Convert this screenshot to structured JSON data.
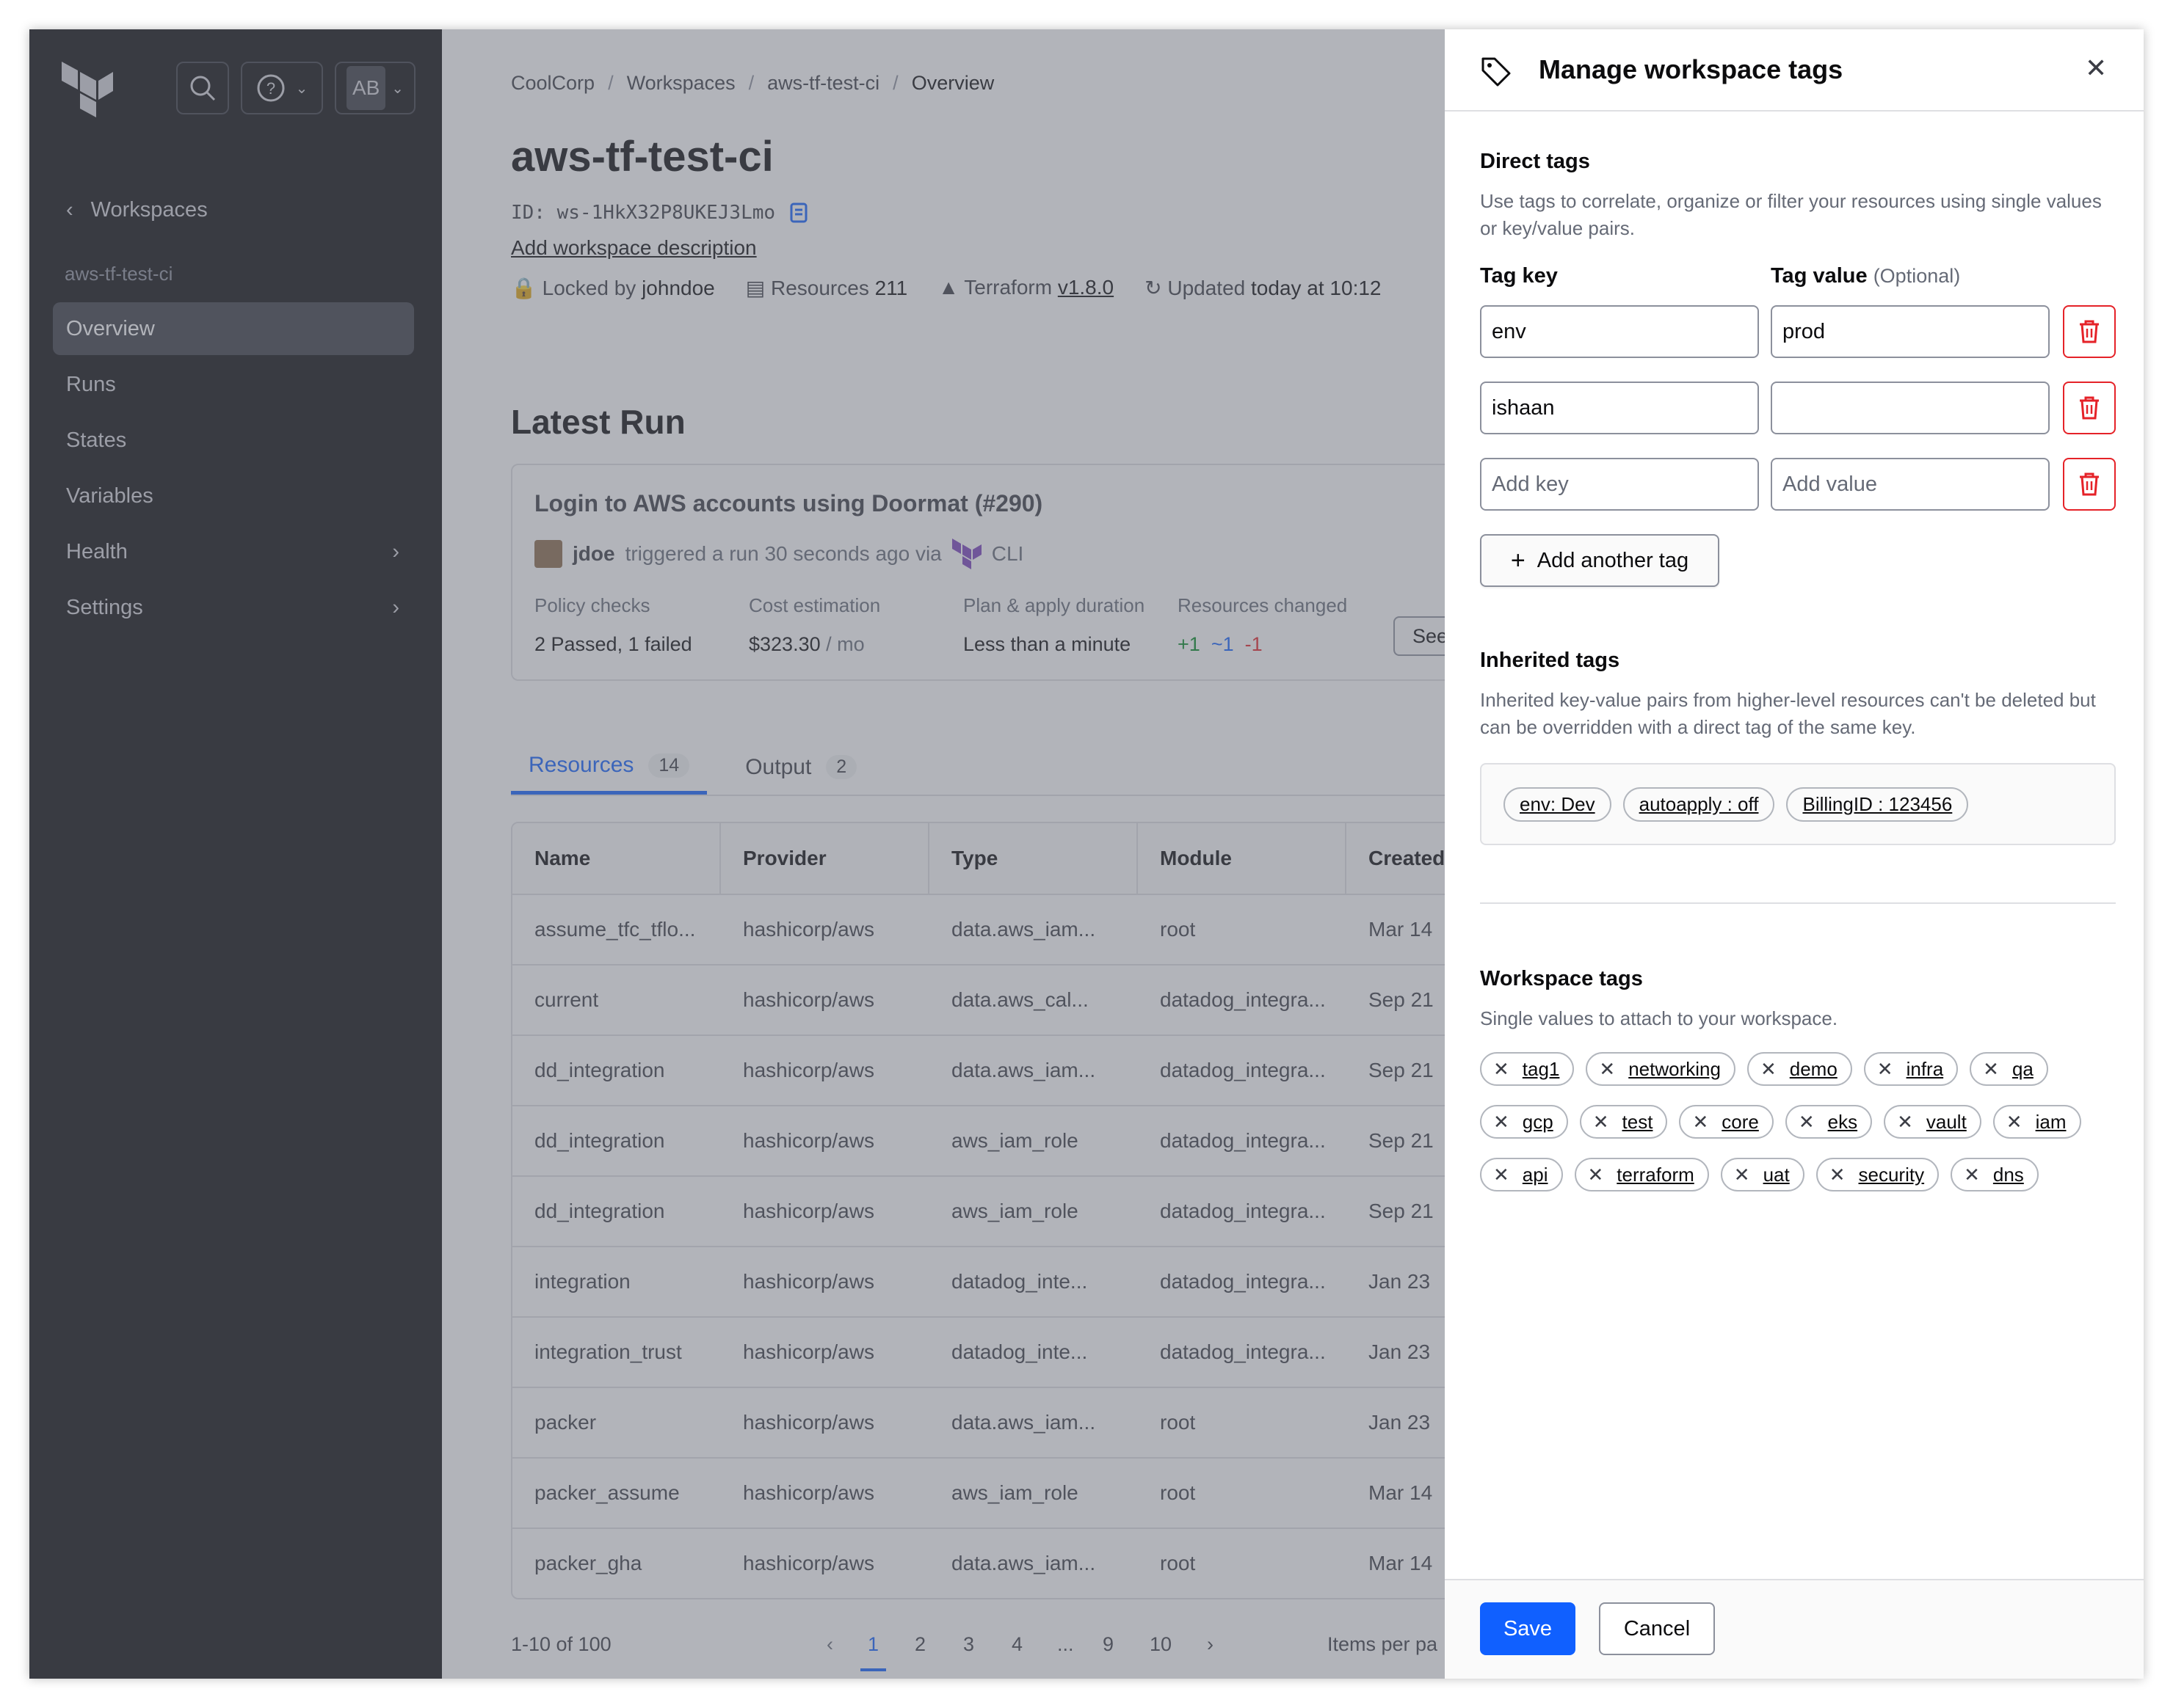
{
  "sidebar": {
    "back_label": "Workspaces",
    "workspace_name": "aws-tf-test-ci",
    "avatar_initials": "AB",
    "items": [
      {
        "label": "Overview",
        "active": true
      },
      {
        "label": "Runs"
      },
      {
        "label": "States"
      },
      {
        "label": "Variables"
      },
      {
        "label": "Health",
        "chevron": true
      },
      {
        "label": "Settings",
        "chevron": true
      }
    ]
  },
  "breadcrumb": [
    "CoolCorp",
    "Workspaces",
    "aws-tf-test-ci",
    "Overview"
  ],
  "workspace": {
    "title": "aws-tf-test-ci",
    "id_text": "ID: ws-1HkX32P8UKEJ3Lmo",
    "description_link": "Add workspace description",
    "locked_label": "Locked by",
    "locked_by": "johndoe",
    "resources_label": "Resources",
    "resources_count": "211",
    "terraform_label": "Terraform",
    "terraform_version": "v1.8.0",
    "updated_label": "Updated",
    "updated_value": "today at 10:12"
  },
  "latest_run": {
    "heading": "Latest Run",
    "title": "Login to AWS accounts using Doormat (#290)",
    "user": "jdoe",
    "trigger_text": "triggered a run 30 seconds ago via",
    "via": "CLI",
    "policy_label": "Policy checks",
    "policy_value": "2 Passed, 1 failed",
    "cost_label": "Cost estimation",
    "cost_value": "$323.30",
    "cost_unit": "/ mo",
    "duration_label": "Plan & apply duration",
    "duration_value": "Less than a minute",
    "changed_label": "Resources changed",
    "changed_add": "+1",
    "changed_change": "~1",
    "changed_destroy": "-1",
    "see_button": "See"
  },
  "tabs": [
    {
      "label": "Resources",
      "count": "14",
      "active": true
    },
    {
      "label": "Output",
      "count": "2"
    }
  ],
  "table": {
    "headers": [
      "Name",
      "Provider",
      "Type",
      "Module",
      "Created"
    ],
    "rows": [
      [
        "assume_tfc_tflo...",
        "hashicorp/aws",
        "data.aws_iam...",
        "root",
        "Mar 14"
      ],
      [
        "current",
        "hashicorp/aws",
        "data.aws_cal...",
        "datadog_integra...",
        "Sep 21"
      ],
      [
        "dd_integration",
        "hashicorp/aws",
        "data.aws_iam...",
        "datadog_integra...",
        "Sep 21"
      ],
      [
        "dd_integration",
        "hashicorp/aws",
        "aws_iam_role",
        "datadog_integra...",
        "Sep 21"
      ],
      [
        "dd_integration",
        "hashicorp/aws",
        "aws_iam_role",
        "datadog_integra...",
        "Sep 21"
      ],
      [
        "integration",
        "hashicorp/aws",
        "datadog_inte...",
        "datadog_integra...",
        "Jan 23"
      ],
      [
        "integration_trust",
        "hashicorp/aws",
        "datadog_inte...",
        "datadog_integra...",
        "Jan 23"
      ],
      [
        "packer",
        "hashicorp/aws",
        "data.aws_iam...",
        "root",
        "Jan 23"
      ],
      [
        "packer_assume",
        "hashicorp/aws",
        "aws_iam_role",
        "root",
        "Mar 14"
      ],
      [
        "packer_gha",
        "hashicorp/aws",
        "data.aws_iam...",
        "root",
        "Mar 14"
      ]
    ]
  },
  "pagination": {
    "range": "1-10 of 100",
    "pages": [
      "1",
      "2",
      "3",
      "4",
      "...",
      "9",
      "10"
    ],
    "current": "1",
    "items_per_page": "Items per pa"
  },
  "drawer": {
    "title": "Manage workspace tags",
    "direct": {
      "heading": "Direct tags",
      "help": "Use tags to correlate, organize or filter your resources using single values or key/value pairs.",
      "key_label": "Tag key",
      "value_label": "Tag value",
      "value_optional": "(Optional)",
      "rows": [
        {
          "key": "env",
          "value": "prod"
        },
        {
          "key": "ishaan",
          "value": ""
        }
      ],
      "key_placeholder": "Add key",
      "value_placeholder": "Add value",
      "add_button": "Add another tag"
    },
    "inherited": {
      "heading": "Inherited tags",
      "help": "Inherited key-value pairs from higher-level resources can't be deleted but can be overridden with a direct tag of the same key.",
      "tags": [
        "env: Dev",
        "autoapply : off",
        "BillingID : 123456"
      ]
    },
    "workspace_tags": {
      "heading": "Workspace tags",
      "help": "Single values to attach to your workspace.",
      "tags": [
        "tag1",
        "networking",
        "demo",
        "infra",
        "qa",
        "gcp",
        "test",
        "core",
        "eks",
        "vault",
        "iam",
        "api",
        "terraform",
        "uat",
        "security",
        "dns"
      ]
    },
    "save_label": "Save",
    "cancel_label": "Cancel"
  },
  "colors": {
    "accent": "#1060ff",
    "danger": "#e52228",
    "sidebar_bg": "#0c0c0e",
    "terraform_purple": "#7b42bc"
  }
}
